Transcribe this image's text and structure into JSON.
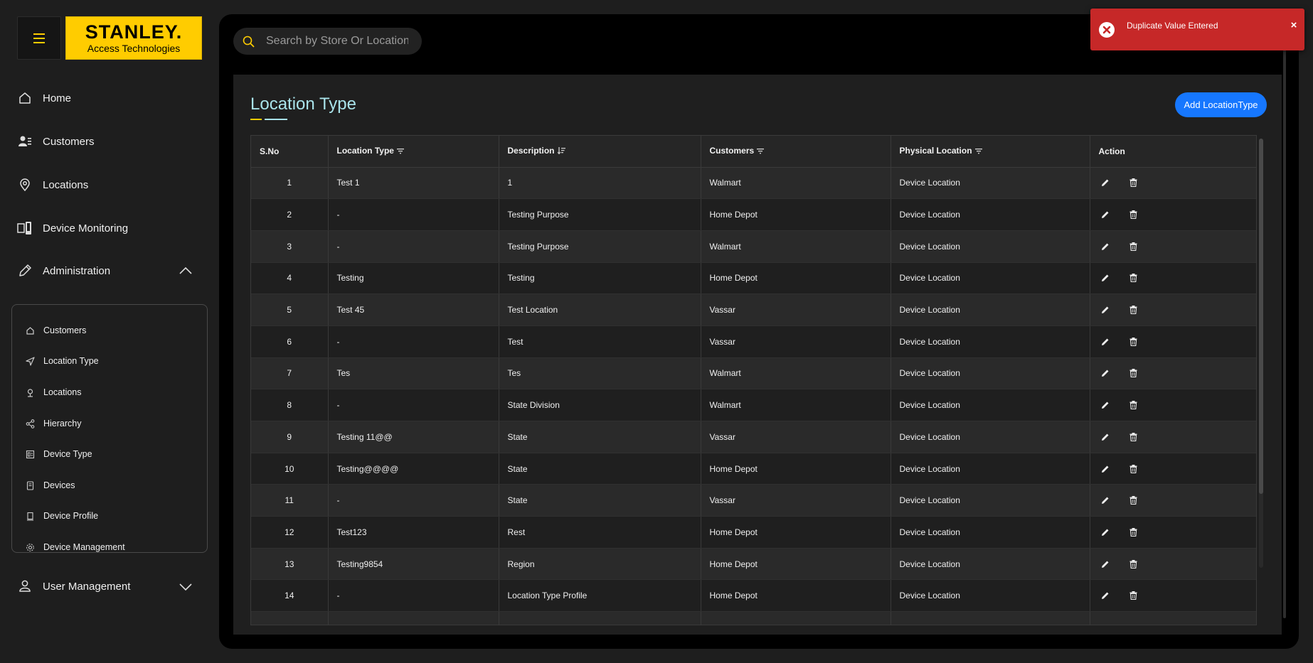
{
  "brand": {
    "name": "STANLEY.",
    "tagline": "Access Technologies",
    "color": "#ffcc00"
  },
  "nav": {
    "menu_icon": "hamburger-icon",
    "home": "Home",
    "customers": "Customers",
    "locations": "Locations",
    "device_monitoring": "Device Monitoring",
    "administration": "Administration",
    "user_management": "User Management"
  },
  "admin_submenu": [
    {
      "label": "Customers",
      "icon": "home-icon"
    },
    {
      "label": "Location Type",
      "icon": "send-icon"
    },
    {
      "label": "Locations",
      "icon": "pin-icon"
    },
    {
      "label": "Hierarchy",
      "icon": "share-icon"
    },
    {
      "label": "Device Type",
      "icon": "device-type-icon"
    },
    {
      "label": "Devices",
      "icon": "device-icon"
    },
    {
      "label": "Device Profile",
      "icon": "profile-icon"
    },
    {
      "label": "Device Management",
      "icon": "gear-icon"
    }
  ],
  "search": {
    "placeholder": "Search by Store Or Location"
  },
  "page": {
    "title": "Location Type",
    "add_button": "Add LocationType"
  },
  "table": {
    "headers": {
      "sno": "S.No",
      "location_type": "Location Type",
      "description": "Description",
      "customers": "Customers",
      "physical_location": "Physical Location",
      "action": "Action"
    },
    "rows": [
      {
        "sno": "1",
        "type": "Test 1",
        "desc": "1",
        "customer": "Walmart",
        "physical": "Device Location"
      },
      {
        "sno": "2",
        "type": "-",
        "desc": "Testing Purpose",
        "customer": "Home Depot",
        "physical": "Device Location"
      },
      {
        "sno": "3",
        "type": "-",
        "desc": "Testing Purpose",
        "customer": "Walmart",
        "physical": "Device Location"
      },
      {
        "sno": "4",
        "type": "Testing",
        "desc": "Testing",
        "customer": "Home Depot",
        "physical": "Device Location"
      },
      {
        "sno": "5",
        "type": "Test 45",
        "desc": "Test Location",
        "customer": "Vassar",
        "physical": "Device Location"
      },
      {
        "sno": "6",
        "type": "-",
        "desc": "Test",
        "customer": "Vassar",
        "physical": "Device Location"
      },
      {
        "sno": "7",
        "type": "Tes",
        "desc": "Tes",
        "customer": "Walmart",
        "physical": "Device Location"
      },
      {
        "sno": "8",
        "type": "-",
        "desc": "State Division",
        "customer": "Walmart",
        "physical": "Device Location"
      },
      {
        "sno": "9",
        "type": "Testing 11@@",
        "desc": "State",
        "customer": "Vassar",
        "physical": "Device Location"
      },
      {
        "sno": "10",
        "type": "Testing@@@@",
        "desc": "State",
        "customer": "Home Depot",
        "physical": "Device Location"
      },
      {
        "sno": "11",
        "type": "-",
        "desc": "State",
        "customer": "Vassar",
        "physical": "Device Location"
      },
      {
        "sno": "12",
        "type": "Test123",
        "desc": "Rest",
        "customer": "Home Depot",
        "physical": "Device Location"
      },
      {
        "sno": "13",
        "type": "Testing9854",
        "desc": "Region",
        "customer": "Home Depot",
        "physical": "Device Location"
      },
      {
        "sno": "14",
        "type": "-",
        "desc": "Location Type Profile",
        "customer": "Home Depot",
        "physical": "Device Location"
      },
      {
        "sno": "",
        "type": "",
        "desc": "",
        "customer": "",
        "physical": ""
      }
    ]
  },
  "toast": {
    "message": "Duplicate Value Entered",
    "close": "×",
    "color": "#c62828"
  },
  "colors": {
    "accent": "#1677ff",
    "title": "#a9e3ea",
    "brand": "#ffcc00"
  }
}
